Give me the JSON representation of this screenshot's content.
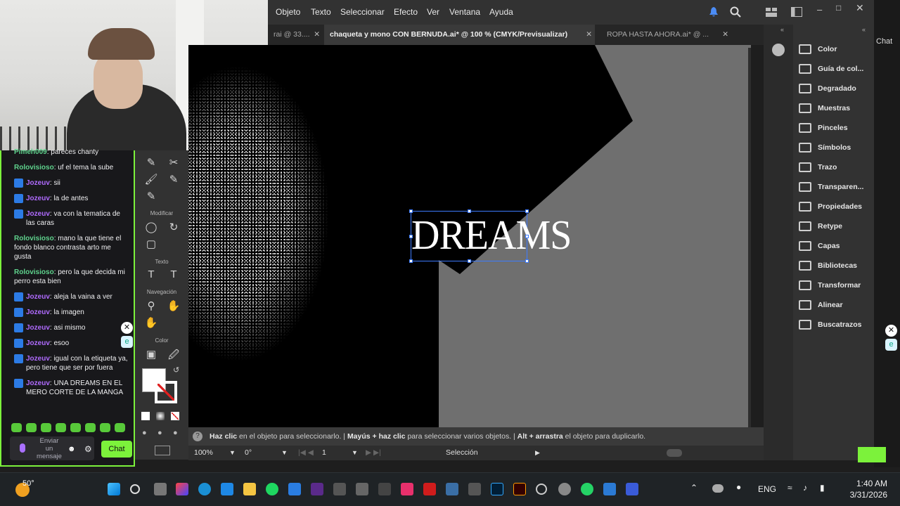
{
  "menubar": {
    "items": [
      "Objeto",
      "Texto",
      "Seleccionar",
      "Efecto",
      "Ver",
      "Ventana",
      "Ayuda"
    ]
  },
  "tabs": [
    {
      "label": "rai @ 33....",
      "active": false
    },
    {
      "label": "chaqueta y mono CON BERNUDA.ai* @ 100 % (CMYK/Previsualizar)",
      "active": true
    },
    {
      "label": "ROPA HASTA AHORA.ai* @ ...",
      "active": false
    }
  ],
  "chat": {
    "messages": [
      {
        "user": "Pimeh009",
        "text": ": pareces chanty",
        "color": "green",
        "badge": false
      },
      {
        "user": "Rolovisioso",
        "text": ": uf el tema la sube",
        "color": "green",
        "badge": false
      },
      {
        "user": "Jozeuv",
        "text": ": sii",
        "color": "purple",
        "badge": true
      },
      {
        "user": "Jozeuv",
        "text": ": la de antes",
        "color": "purple",
        "badge": true
      },
      {
        "user": "Jozeuv",
        "text": ": va con la tematica de las caras",
        "color": "purple",
        "badge": true
      },
      {
        "user": "Rolovisioso",
        "text": ": mano la que tiene el fondo blanco contrasta arto me gusta",
        "color": "green",
        "badge": false
      },
      {
        "user": "Rolovisioso",
        "text": ": pero la que decida mi perro esta bien",
        "color": "green",
        "badge": false
      },
      {
        "user": "Jozeuv",
        "text": ": aleja la vaina a ver",
        "color": "purple",
        "badge": true
      },
      {
        "user": "Jozeuv",
        "text": ": la imagen",
        "color": "purple",
        "badge": true
      },
      {
        "user": "Jozeuv",
        "text": ": asi mismo",
        "color": "purple",
        "badge": true
      },
      {
        "user": "Jozeuv",
        "text": ": esoo",
        "color": "purple",
        "badge": true
      },
      {
        "user": "Jozeuv",
        "text": ": igual con la etiqueta ya, pero tiene que ser por fuera",
        "color": "purple",
        "badge": true
      },
      {
        "user": "Jozeuv",
        "text": ": UNA DREAMS EN EL MERO CORTE DE LA MANGA",
        "color": "purple",
        "badge": true
      }
    ],
    "input_placeholder": "Enviar un mensaje",
    "send_label": "Chat",
    "header_label": "Chat"
  },
  "tools": {
    "modificar": "Modificar",
    "texto": "Texto",
    "navegacion": "Navegación",
    "color": "Color"
  },
  "canvas": {
    "text_object": "DREAMS"
  },
  "panels": [
    {
      "label": "Color",
      "icon": "palette-icon"
    },
    {
      "label": "Guía de col...",
      "icon": "color-guide-icon"
    },
    {
      "label": "Degradado",
      "icon": "gradient-icon"
    },
    {
      "label": "Muestras",
      "icon": "swatches-icon"
    },
    {
      "label": "Pinceles",
      "icon": "brushes-icon"
    },
    {
      "label": "Símbolos",
      "icon": "symbols-icon"
    },
    {
      "label": "Trazo",
      "icon": "stroke-icon"
    },
    {
      "label": "Transparen...",
      "icon": "transparency-icon"
    },
    {
      "label": "Propiedades",
      "icon": "properties-icon"
    },
    {
      "label": "Retype",
      "icon": "retype-icon"
    },
    {
      "label": "Capas",
      "icon": "layers-icon"
    },
    {
      "label": "Bibliotecas",
      "icon": "libraries-icon"
    },
    {
      "label": "Transformar",
      "icon": "transform-icon"
    },
    {
      "label": "Alinear",
      "icon": "align-icon"
    },
    {
      "label": "Buscatrazos",
      "icon": "pathfinder-icon"
    }
  ],
  "hint": {
    "p1b": "Haz clic",
    "p1": " en el objeto para seleccionarlo.  |  ",
    "p2b": "Mayús + haz clic",
    "p2": " para seleccionar varios objetos.  |  ",
    "p3b": "Alt + arrastra",
    "p3": " el objeto para duplicarlo."
  },
  "statusbar": {
    "zoom": "100%",
    "rotation": "0°",
    "artboard": "1",
    "tool": "Selección"
  },
  "taskbar": {
    "weather": "50°",
    "lang": "ENG",
    "time": "1:40 AM",
    "date": "3/31/2026"
  },
  "colors": {
    "accent_green": "#7cf23b",
    "selection_blue": "#3d7bff",
    "pasteboard": "#6f6f6f"
  }
}
